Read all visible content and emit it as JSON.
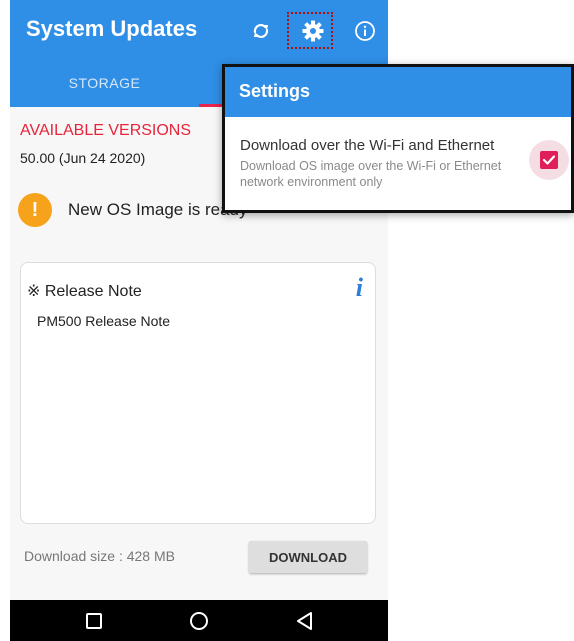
{
  "appbar": {
    "title": "System Updates",
    "refresh_icon": "refresh-icon",
    "gear_icon": "gear-icon",
    "info_icon": "info-circle-icon",
    "color": "#2f8ee6"
  },
  "tabs": [
    {
      "label": "STORAGE"
    }
  ],
  "available": {
    "title": "AVAILABLE VERSIONS",
    "version": "50.00 (Jun 24 2020)",
    "status_icon": "exclamation-icon",
    "status_text": "New OS Image is ready"
  },
  "release": {
    "heading": "※ Release Note",
    "info_icon_glyph": "i",
    "body": "PM500 Release Note"
  },
  "footer": {
    "download_size": "Download size : 428 MB",
    "download_label": "DOWNLOAD"
  },
  "settings_popup": {
    "title": "Settings",
    "option_title": "Download over the Wi-Fi and Ethernet",
    "option_desc": "Download OS image over the Wi-Fi or Ethernet network environment only",
    "checked": true,
    "accent": "#e01f5a"
  },
  "navbar": {
    "recent_icon": "square-icon",
    "home_icon": "circle-icon",
    "back_icon": "triangle-back-icon"
  }
}
